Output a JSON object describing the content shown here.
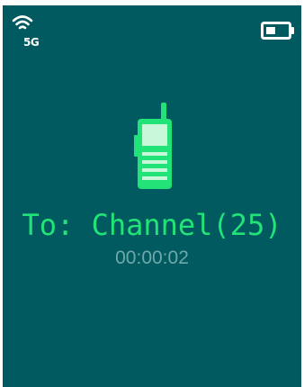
{
  "status_bar": {
    "network_label": "5G",
    "signal_icon": "wifi-signal-icon",
    "battery_icon": "battery-icon",
    "battery_level": 0.45
  },
  "call": {
    "icon": "walkie-talkie-icon",
    "target": "To: Channel(25)",
    "duration": "00:00:02"
  },
  "colors": {
    "background": "#005a5f",
    "accent": "#22e377",
    "timer": "#6fa8aa",
    "icon_light": "#ffffff"
  }
}
